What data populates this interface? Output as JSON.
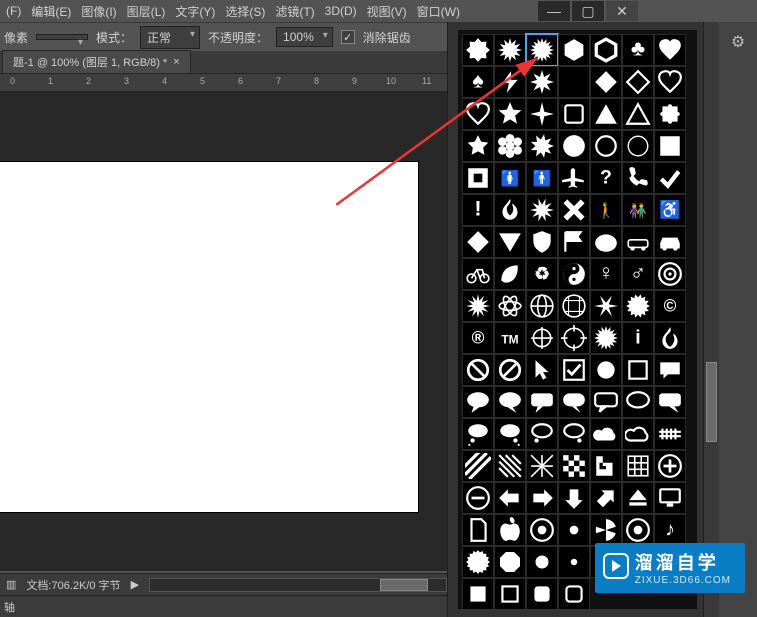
{
  "menubar": {
    "items": [
      "(F)",
      "编辑(E)",
      "图像(I)",
      "图层(L)",
      "文字(Y)",
      "选择(S)",
      "滤镜(T)",
      "3D(D)",
      "视图(V)",
      "窗口(W)"
    ]
  },
  "window_controls": {
    "min": "—",
    "max": "▢",
    "close": "✕"
  },
  "options": {
    "unit": "像素",
    "mode_label": "模式：",
    "mode_value": "正常",
    "opacity_label": "不透明度：",
    "opacity_value": "100%",
    "antialias_checked": "✓",
    "antialias_label": "消除锯齿"
  },
  "tab": {
    "title": "题-1 @ 100% (图层 1, RGB/8) *",
    "close": "×"
  },
  "ruler": [
    "0",
    "1",
    "2",
    "3",
    "4",
    "5",
    "6",
    "7",
    "8",
    "9",
    "10",
    "11"
  ],
  "status": {
    "icon": "▥",
    "doc": "文档:706.2K/0 字节",
    "play": "▶"
  },
  "bottom": {
    "label": "轴"
  },
  "panel": {
    "gear": "⚙"
  },
  "shapes": [
    "blob",
    "burst12",
    "burst16",
    "hexagon",
    "hexring",
    "club",
    "heart",
    "spade",
    "bolt",
    "star8",
    "moon",
    "diamond",
    "diamond-o",
    "heart-o",
    "heart-line",
    "star5",
    "sparkle",
    "square-o",
    "triangle",
    "triangle-o",
    "puzzle",
    "flower5",
    "flower6",
    "splat",
    "circle",
    "circle-o",
    "circle-thin",
    "square",
    "square-inset",
    "woman",
    "man",
    "plane",
    "question",
    "phone",
    "check",
    "exclaim",
    "flame",
    "splash",
    "xmark",
    "walk",
    "people",
    "wheelchair",
    "diamond2",
    "tri-down",
    "shield",
    "flag",
    "blob2",
    "car-o",
    "car",
    "bike",
    "leaf",
    "recycle",
    "yinyang",
    "female",
    "male",
    "target",
    "burst",
    "atom",
    "globe",
    "grid-o",
    "asterisk",
    "badge",
    "copyright",
    "registered",
    "tm",
    "crosshair",
    "crosshair2",
    "sun3",
    "info-i",
    "fire",
    "no",
    "no2",
    "cursor",
    "checkbox",
    "blank",
    "square-line",
    "bubble",
    "bubble2",
    "bubble3",
    "bubble4",
    "bubble5",
    "bubble6",
    "bubble7",
    "bubble8",
    "think1",
    "think2",
    "think3",
    "think4",
    "cloud",
    "cloud2",
    "rail",
    "stripes",
    "hatch",
    "x-lines",
    "checker",
    "greek",
    "grid9",
    "circle-plus",
    "circle-minus",
    "arrow-l",
    "arrow-r",
    "arrow-d",
    "arrow-ur",
    "eject",
    "pc",
    "doc",
    "apple",
    "target2",
    "dot",
    "fan",
    "radio",
    "music",
    "stamp",
    "oct",
    "dot2",
    "dot3",
    "circ",
    "clock",
    "hand",
    "sq",
    "sq2",
    "sq3",
    "sq4"
  ],
  "watermark": {
    "brand": "溜溜自学",
    "url": "ZIXUE.3D66.COM"
  }
}
